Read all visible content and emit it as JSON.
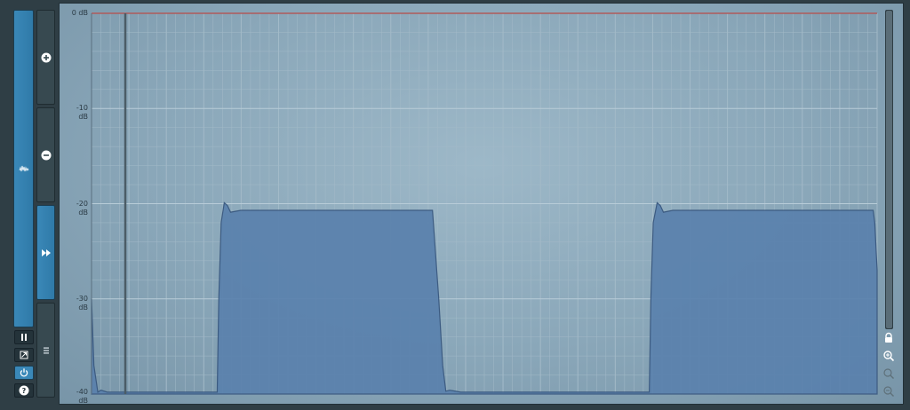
{
  "colors": {
    "accent": "#3a88b8",
    "fill": "#5a81ad",
    "fill_stroke": "#36557d",
    "clip_line": "#b05a5a",
    "grid_major": "#b8ccd8",
    "grid_minor": "#a3bac8"
  },
  "left_panel": {
    "mode_icon": "waveform-mode-icon",
    "buttons": [
      {
        "name": "zoom-in-button",
        "icon": "plus-circle-icon"
      },
      {
        "name": "zoom-out-button",
        "icon": "minus-circle-icon"
      },
      {
        "name": "fast-forward-button",
        "icon": "fast-forward-icon"
      },
      {
        "name": "menu-button",
        "icon": "hamburger-icon"
      }
    ],
    "small_buttons": [
      {
        "name": "pause-button",
        "icon": "pause-icon"
      },
      {
        "name": "export-button",
        "icon": "export-icon"
      },
      {
        "name": "power-button",
        "icon": "power-icon"
      },
      {
        "name": "help-button",
        "icon": "help-icon"
      }
    ]
  },
  "chart_data": {
    "type": "area",
    "y_unit": "dB",
    "ylim": [
      -40,
      0
    ],
    "y_ticks": [
      0,
      -10,
      -20,
      -30,
      -40
    ],
    "y_tick_labels": [
      "0 dB",
      "-10 dB",
      "-20 dB",
      "-30 dB",
      "-40 dB"
    ],
    "x_range": [
      0,
      1
    ],
    "grid": true,
    "clip_level": 0,
    "playhead_x": 0.043,
    "series": [
      {
        "points": [
          [
            0.0,
            -30
          ],
          [
            0.003,
            -37
          ],
          [
            0.008,
            -39.8
          ],
          [
            0.012,
            -39.6
          ],
          [
            0.02,
            -39.8
          ],
          [
            0.16,
            -39.8
          ],
          [
            0.162,
            -30
          ],
          [
            0.165,
            -22
          ],
          [
            0.169,
            -19.9
          ],
          [
            0.173,
            -20.2
          ],
          [
            0.177,
            -20.9
          ],
          [
            0.19,
            -20.7
          ],
          [
            0.21,
            -20.7
          ],
          [
            0.434,
            -20.7
          ],
          [
            0.436,
            -23
          ],
          [
            0.442,
            -30
          ],
          [
            0.447,
            -37
          ],
          [
            0.451,
            -39.7
          ],
          [
            0.456,
            -39.6
          ],
          [
            0.47,
            -39.8
          ],
          [
            0.71,
            -39.8
          ],
          [
            0.712,
            -30
          ],
          [
            0.715,
            -22
          ],
          [
            0.72,
            -19.9
          ],
          [
            0.724,
            -20.2
          ],
          [
            0.728,
            -20.9
          ],
          [
            0.74,
            -20.7
          ],
          [
            0.76,
            -20.7
          ],
          [
            0.995,
            -20.7
          ],
          [
            0.997,
            -22
          ],
          [
            1.0,
            -27
          ]
        ]
      }
    ]
  },
  "right_tools": {
    "icons": [
      "lock-icon",
      "zoom-icon",
      "zoom-reset-icon",
      "zoom-out-disabled-icon"
    ]
  }
}
